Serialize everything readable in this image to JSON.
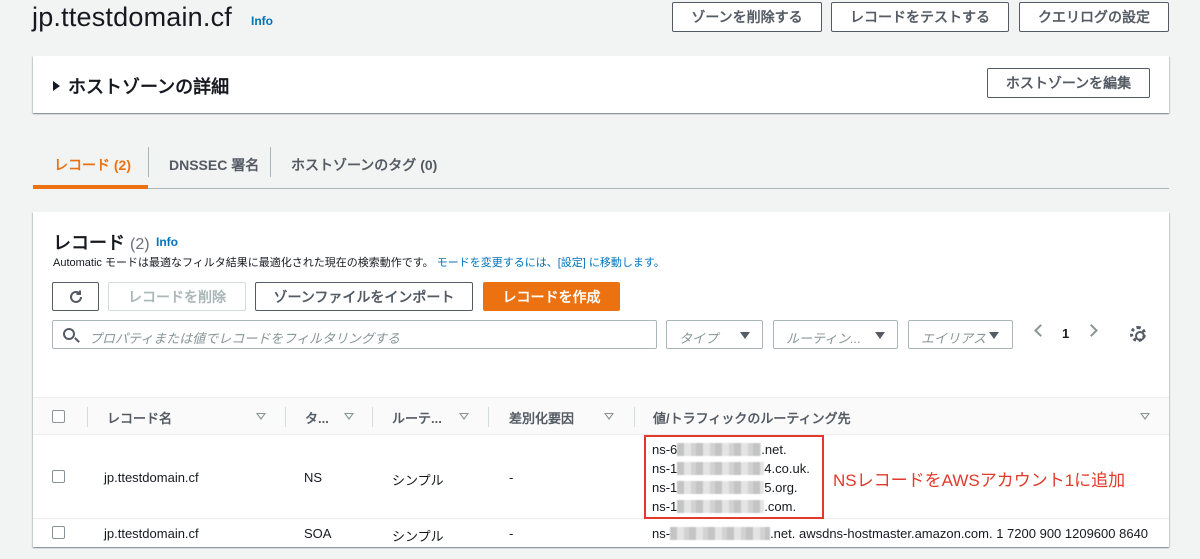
{
  "header": {
    "title": "jp.ttestdomain.cf",
    "info": "Info",
    "buttons": {
      "delete_zone": "ゾーンを削除する",
      "test_record": "レコードをテストする",
      "query_log": "クエリログの設定"
    }
  },
  "details": {
    "title": "ホストゾーンの詳細",
    "edit_button": "ホストゾーンを編集"
  },
  "tabs": [
    {
      "label": "レコード (2)",
      "active": true
    },
    {
      "label": "DNSSEC 署名",
      "active": false
    },
    {
      "label": "ホストゾーンのタグ (0)",
      "active": false
    }
  ],
  "records": {
    "title": "レコード",
    "count": "(2)",
    "info": "Info",
    "description": "Automatic モードは最適なフィルタ結果に最適化された現在の検索動作です。",
    "description_link": "モードを変更するには、[設定] に移動します。",
    "buttons": {
      "delete": "レコードを削除",
      "import": "ゾーンファイルをインポート",
      "create": "レコードを作成"
    },
    "search_placeholder": "プロパティまたは値でレコードをフィルタリングする",
    "filters": {
      "type": "タイプ",
      "routing": "ルーティン...",
      "alias": "エイリアス"
    },
    "page": "1",
    "columns": [
      "レコード名",
      "タ...",
      "ルーテ...",
      "差別化要因",
      "値/トラフィックのルーティング先"
    ],
    "rows": [
      {
        "name": "jp.ttestdomain.cf",
        "type": "NS",
        "routing": "シンプル",
        "differentiator": "-",
        "values": [
          {
            "prefix": "ns-6",
            "suffix": ".net."
          },
          {
            "prefix": "ns-1",
            "suffix": "4.co.uk."
          },
          {
            "prefix": "ns-1",
            "suffix": "5.org."
          },
          {
            "prefix": "ns-1",
            "suffix": ".com."
          }
        ]
      },
      {
        "name": "jp.ttestdomain.cf",
        "type": "SOA",
        "routing": "シンプル",
        "differentiator": "-",
        "value_prefix": "ns-",
        "value_suffix": ".net. awsdns-hostmaster.amazon.com. 1 7200 900 1209600 8640"
      }
    ]
  },
  "annotation": "NSレコードをAWSアカウント1に追加",
  "colors": {
    "accent": "#ec7211",
    "link": "#0073bb",
    "annotation": "#e13a2a"
  }
}
